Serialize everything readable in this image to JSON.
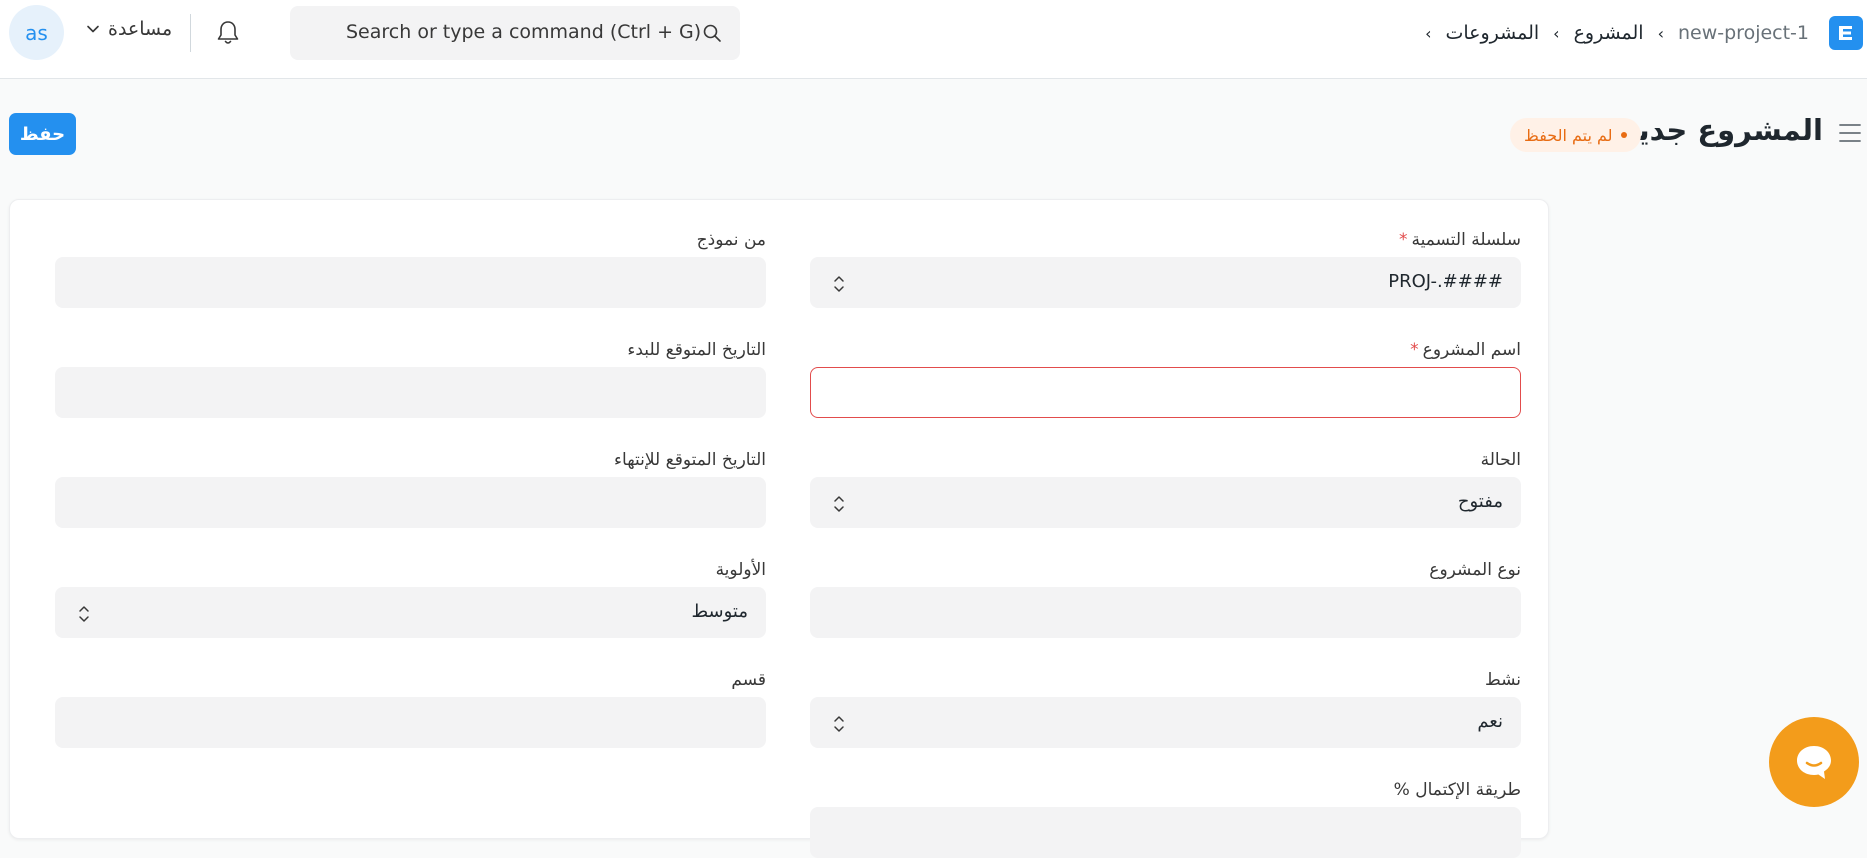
{
  "navbar": {
    "breadcrumbs": [
      "المشروعات",
      "المشروع",
      "new-project-1"
    ],
    "search_placeholder": "Search or type a command (Ctrl + G)",
    "help_label": "مساعدة",
    "avatar_initials": "as"
  },
  "page": {
    "title": "المشروع جديد",
    "status": "لم يتم الحفظ",
    "save_label": "حفظ"
  },
  "form": {
    "naming_series": {
      "label": "سلسلة التسمية",
      "required_mark": "*",
      "value": "PROJ-.####"
    },
    "from_template": {
      "label": "من نموذج",
      "value": ""
    },
    "project_name": {
      "label": "اسم المشروع",
      "required_mark": "*",
      "value": ""
    },
    "expected_start": {
      "label": "التاريخ المتوقع للبدء",
      "value": ""
    },
    "status": {
      "label": "الحالة",
      "value": "مفتوح"
    },
    "expected_end": {
      "label": "التاريخ المتوقع للإنتهاء",
      "value": ""
    },
    "project_type": {
      "label": "نوع المشروع",
      "value": ""
    },
    "priority": {
      "label": "الأولوية",
      "value": "متوسط"
    },
    "is_active": {
      "label": "نشط",
      "value": "نعم"
    },
    "department": {
      "label": "قسم",
      "value": ""
    },
    "percent_complete_method": {
      "label": "طريقة الإكتمال %",
      "value": ""
    }
  },
  "colors": {
    "accent": "#2490ef",
    "unsaved": "#e86c13",
    "error_border": "#e24c4c",
    "chat": "#f39c1b"
  },
  "icons": [
    "app-logo-icon",
    "chevron-right-icon",
    "search-icon",
    "bell-icon",
    "chevron-down-icon",
    "hamburger-icon",
    "select-arrows-icon",
    "chat-icon"
  ]
}
